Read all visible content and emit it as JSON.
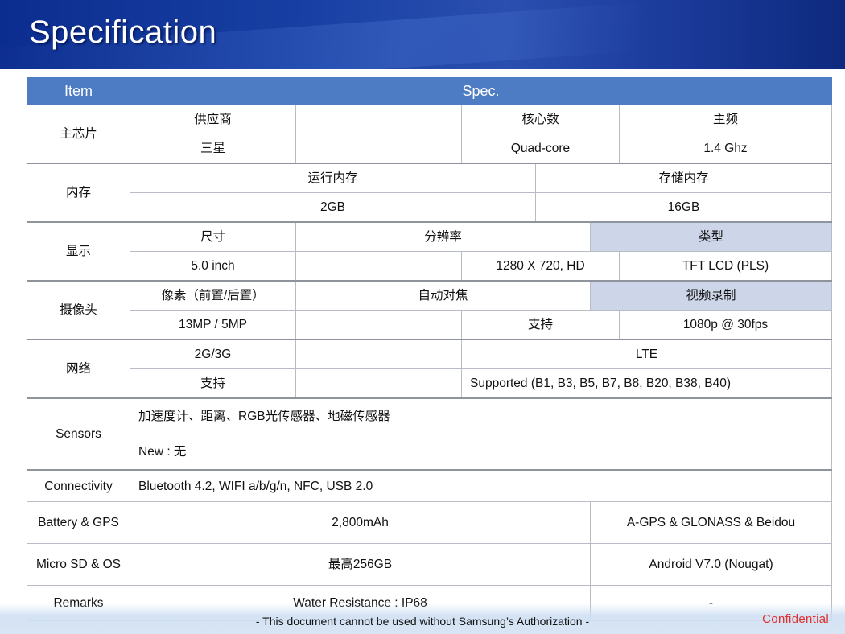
{
  "page": {
    "title": "Specification",
    "disclaimer": "- This document cannot be used without Samsung’s Authorization -",
    "confidential": "Confidential"
  },
  "table": {
    "header": {
      "item": "Item",
      "spec": "Spec."
    },
    "chip": {
      "label": "主芯片",
      "h1": "供应商",
      "h2": "",
      "h3": "核心数",
      "h4": "主频",
      "v1": "三星",
      "v2": "",
      "v3": "Quad-core",
      "v4": "1.4 Ghz"
    },
    "memory": {
      "label": "内存",
      "h1": "运行内存",
      "h2": "存储内存",
      "v1": "2GB",
      "v2": "16GB"
    },
    "display": {
      "label": "显示",
      "h1": "尺寸",
      "h2": "分辨率",
      "h3": "类型",
      "v1": "5.0 inch",
      "v2": "",
      "v3": "1280 X 720, HD",
      "v4": "TFT LCD (PLS)"
    },
    "camera": {
      "label": "摄像头",
      "h1": "像素（前置/后置）",
      "h2": "自动对焦",
      "h3": "视频录制",
      "v1": "13MP / 5MP",
      "v2": "",
      "v3": "支持",
      "v4": "1080p @ 30fps"
    },
    "network": {
      "label": "网络",
      "h1": "2G/3G",
      "h2": "",
      "h3": "LTE",
      "v1": "支持",
      "v2": "",
      "v3": "Supported (B1, B3, B5, B7, B8, B20, B38, B40)"
    },
    "sensors": {
      "label": "Sensors",
      "v1": "加速度计、距离、RGB光传感器、地磁传感器",
      "v2": "New : 无"
    },
    "connectivity": {
      "label": "Connectivity",
      "v1": "Bluetooth 4.2,  WIFI a/b/g/n,  NFC, USB 2.0"
    },
    "battery": {
      "label": "Battery & GPS",
      "v1": "2,800mAh",
      "v2": "A-GPS & GLONASS & Beidou"
    },
    "storage": {
      "label": "Micro SD & OS",
      "v1": "最高256GB",
      "v2": "Android V7.0 (Nougat)"
    },
    "remarks": {
      "label": "Remarks",
      "v1": "Water Resistance : IP68",
      "v2": "-"
    }
  }
}
